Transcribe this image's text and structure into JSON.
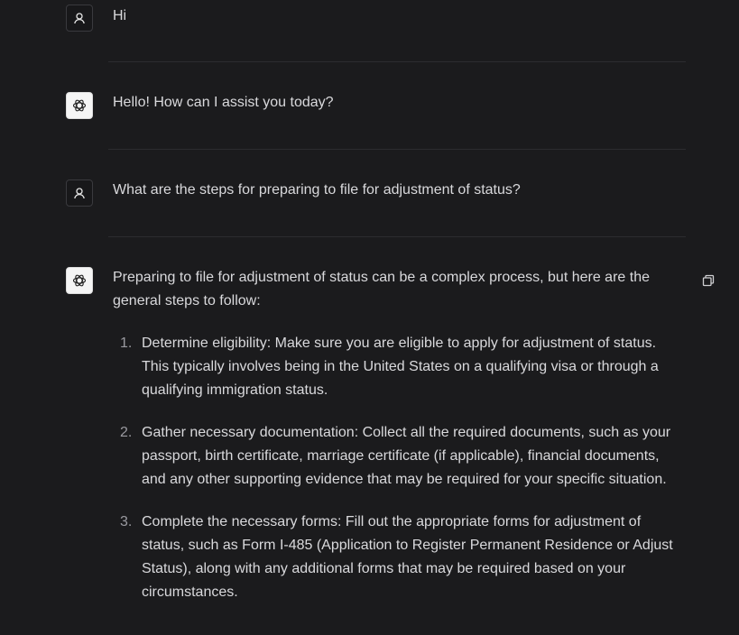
{
  "conversation": {
    "messages": [
      {
        "role": "user",
        "text": "Hi"
      },
      {
        "role": "assistant",
        "text": "Hello! How can I assist you today?"
      },
      {
        "role": "user",
        "text": "What are the steps for preparing to file for adjustment of status?"
      },
      {
        "role": "assistant",
        "text": "Preparing to file for adjustment of status can be a complex process, but here are the general steps to follow:"
      }
    ],
    "steps": [
      {
        "num": "1.",
        "text": "Determine eligibility: Make sure you are eligible to apply for adjustment of status. This typically involves being in the United States on a qualifying visa or through a qualifying immigration status."
      },
      {
        "num": "2.",
        "text": "Gather necessary documentation: Collect all the required documents, such as your passport, birth certificate, marriage certificate (if applicable), financial documents, and any other supporting evidence that may be required for your specific situation."
      },
      {
        "num": "3.",
        "text": "Complete the necessary forms: Fill out the appropriate forms for adjustment of status, such as Form I-485 (Application to Register Permanent Residence or Adjust Status), along with any additional forms that may be required based on your circumstances."
      }
    ]
  },
  "icons": {
    "user_avatar": "user-icon",
    "assistant_avatar": "openai-logo-icon",
    "copy": "copy-icon"
  },
  "colors": {
    "background": "#1b1b1d",
    "text": "#d9d9dc",
    "divider": "#2c2c30"
  }
}
